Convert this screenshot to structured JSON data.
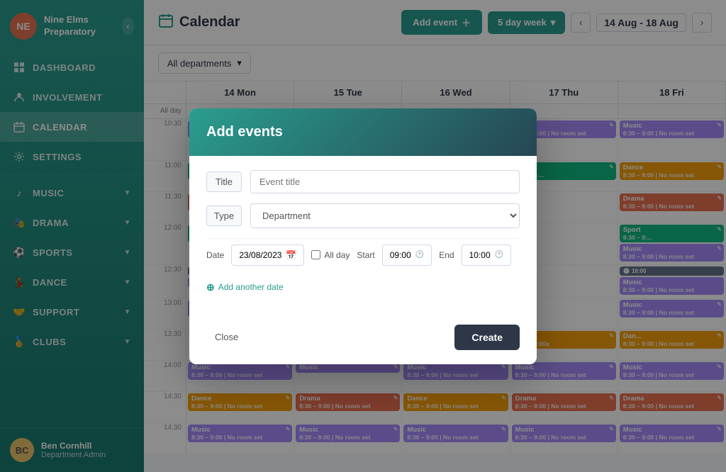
{
  "sidebar": {
    "school": {
      "initials": "NE",
      "name": "Nine Elms Preparatory"
    },
    "nav_items": [
      {
        "id": "dashboard",
        "label": "DASHBOARD",
        "icon": "📊",
        "active": false
      },
      {
        "id": "involvement",
        "label": "INVOLVEMENT",
        "icon": "👤",
        "active": false
      },
      {
        "id": "calendar",
        "label": "CALENDAR",
        "icon": "📅",
        "active": true
      },
      {
        "id": "settings",
        "label": "SETTINGS",
        "icon": "⚙️",
        "active": false
      },
      {
        "id": "music",
        "label": "MUSIC",
        "icon": "",
        "active": false,
        "hasChildren": true
      },
      {
        "id": "drama",
        "label": "DRAMA",
        "icon": "",
        "active": false,
        "hasChildren": true
      },
      {
        "id": "sports",
        "label": "SPORTS",
        "icon": "",
        "active": false,
        "hasChildren": true
      },
      {
        "id": "dance",
        "label": "DANCE",
        "icon": "",
        "active": false,
        "hasChildren": true
      },
      {
        "id": "support",
        "label": "SUPPORT",
        "icon": "",
        "active": false,
        "hasChildren": true
      },
      {
        "id": "clubs",
        "label": "CLUBS",
        "icon": "",
        "active": false,
        "hasChildren": true
      }
    ],
    "user": {
      "name": "Ben Cornhill",
      "role": "Department Admin",
      "initials": "BC"
    }
  },
  "topbar": {
    "title": "Calendar",
    "add_event_label": "Add event",
    "week_view_label": "5 day week",
    "date_range": "14 Aug - 18 Aug"
  },
  "filter": {
    "dept_label": "All departments"
  },
  "calendar": {
    "days": [
      {
        "label": "14 Mon"
      },
      {
        "label": "15 Tue"
      },
      {
        "label": "16 Wed"
      },
      {
        "label": "17 Thu"
      },
      {
        "label": "18 Fri"
      }
    ],
    "all_day_label": "All day"
  },
  "modal": {
    "title": "Add events",
    "fields": {
      "title_label": "Title",
      "title_placeholder": "Event title",
      "type_label": "Type",
      "type_placeholder": "Department"
    },
    "date": {
      "label": "Date",
      "value": "23/08/2023",
      "all_day_label": "All day"
    },
    "time": {
      "start_label": "Start",
      "start_value": "09:00",
      "end_label": "End",
      "end_value": "10:00"
    },
    "add_date_label": "Add another date",
    "close_label": "Close",
    "create_label": "Create"
  }
}
